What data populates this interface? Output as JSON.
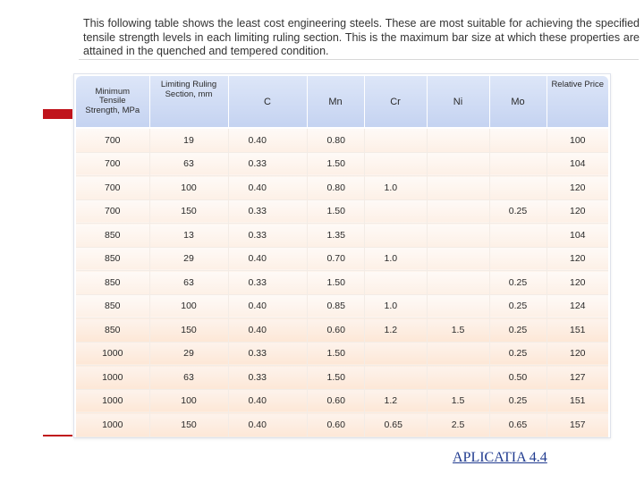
{
  "intro": {
    "text": "This following table shows the least cost engineering steels. These are most suitable for achieving the specified tensile strength levels in each limiting ruling section. This is the maximum bar size at which these properties are attained in the quenched and tempered condition."
  },
  "table": {
    "headers": [
      "Minimum\nTensile\nStrength, MPa",
      "Limiting Ruling\nSection, mm",
      "C",
      "Mn",
      "Cr",
      "Ni",
      "Mo",
      "Relative Price"
    ],
    "rows": [
      [
        "700",
        "19",
        "0.40",
        "0.80",
        "",
        "",
        "",
        "100"
      ],
      [
        "700",
        "63",
        "0.33",
        "1.50",
        "",
        "",
        "",
        "104"
      ],
      [
        "700",
        "100",
        "0.40",
        "0.80",
        "1.0",
        "",
        "",
        "120"
      ],
      [
        "700",
        "150",
        "0.33",
        "1.50",
        "",
        "",
        "0.25",
        "120"
      ],
      [
        "850",
        "13",
        "0.33",
        "1.35",
        "",
        "",
        "",
        "104"
      ],
      [
        "850",
        "29",
        "0.40",
        "0.70",
        "1.0",
        "",
        "",
        "120"
      ],
      [
        "850",
        "63",
        "0.33",
        "1.50",
        "",
        "",
        "0.25",
        "120"
      ],
      [
        "850",
        "100",
        "0.40",
        "0.85",
        "1.0",
        "",
        "0.25",
        "124"
      ],
      [
        "850",
        "150",
        "0.40",
        "0.60",
        "1.2",
        "1.5",
        "0.25",
        "151"
      ],
      [
        "1000",
        "29",
        "0.33",
        "1.50",
        "",
        "",
        "0.25",
        "120"
      ],
      [
        "1000",
        "63",
        "0.33",
        "1.50",
        "",
        "",
        "0.50",
        "127"
      ],
      [
        "1000",
        "100",
        "0.40",
        "0.60",
        "1.2",
        "1.5",
        "0.25",
        "151"
      ],
      [
        "1000",
        "150",
        "0.40",
        "0.60",
        "0.65",
        "2.5",
        "0.65",
        "157"
      ]
    ]
  },
  "link": {
    "label": "APLICATIA 4.4"
  },
  "colors": {
    "header_bg": "#c5d3f1",
    "row_tint": "#fdf0e6",
    "accent_red": "#c0141c",
    "link": "#1f3a8f"
  }
}
